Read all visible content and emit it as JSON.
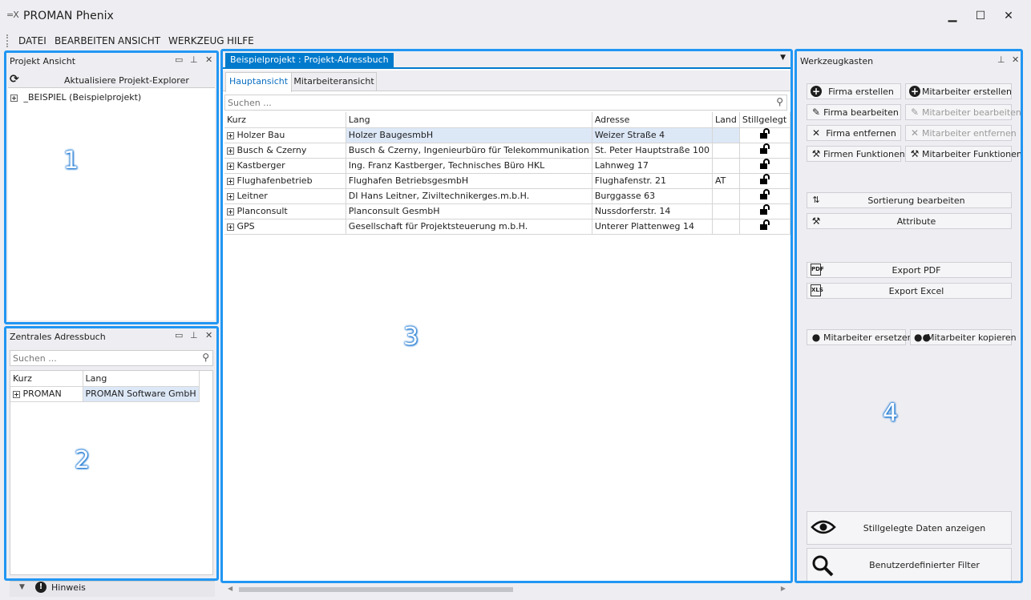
{
  "window": {
    "title": "PROMAN Phenix",
    "logo": "=X",
    "minimize": "▁",
    "maximize": "☐",
    "close": "✕"
  },
  "menu": [
    "DATEI",
    "BEARBEITEN",
    "ANSICHT",
    "WERKZEUG",
    "HILFE"
  ],
  "projekt_ansicht": {
    "title": "Projekt Ansicht",
    "refresh_label": "Aktualisiere Projekt-Explorer",
    "tree": [
      "_BEISPIEL (Beispielprojekt)"
    ],
    "marker": "1"
  },
  "adressbuch": {
    "title": "Zentrales Adressbuch",
    "search_placeholder": "Suchen ...",
    "columns": [
      "Kurz",
      "Lang"
    ],
    "rows": [
      {
        "kurz": "PROMAN",
        "lang": "PROMAN Software GmbH"
      }
    ],
    "marker": "2"
  },
  "hinweis": {
    "label": "Hinweis"
  },
  "center": {
    "doc_tab": "Beispielprojekt : Projekt-Adressbuch",
    "tabs": [
      "Hauptansicht",
      "Mitarbeiteransicht"
    ],
    "search_placeholder": "Suchen ...",
    "columns": [
      "Kurz",
      "Lang",
      "Adresse",
      "Land",
      "Stillgelegt"
    ],
    "rows": [
      {
        "kurz": "Holzer Bau",
        "lang": "Holzer BaugesmbH",
        "adresse": "Weizer Straße 4",
        "land": ""
      },
      {
        "kurz": "Busch & Czerny",
        "lang": "Busch & Czerny, Ingenieurbüro für Telekommunikation",
        "adresse": "St. Peter Hauptstraße 100",
        "land": ""
      },
      {
        "kurz": "Kastberger",
        "lang": "Ing. Franz Kastberger, Technisches Büro HKL",
        "adresse": "Lahnweg 17",
        "land": ""
      },
      {
        "kurz": "Flughafenbetrieb",
        "lang": "Flughafen BetriebsgesmbH",
        "adresse": "Flughafenstr. 21",
        "land": "AT"
      },
      {
        "kurz": "Leitner",
        "lang": "DI Hans Leitner, Ziviltechnikerges.m.b.H.",
        "adresse": "Burggasse 63",
        "land": ""
      },
      {
        "kurz": "Planconsult",
        "lang": "Planconsult GesmbH",
        "adresse": "Nussdorferstr. 14",
        "land": ""
      },
      {
        "kurz": "GPS",
        "lang": "Gesellschaft für Projektsteuerung m.b.H.",
        "adresse": "Unterer Plattenweg 14",
        "land": ""
      }
    ],
    "marker": "3"
  },
  "toolbox": {
    "title": "Werkzeugkasten",
    "buttons": {
      "firma_erstellen": "Firma erstellen",
      "mitarbeiter_erstellen": "Mitarbeiter erstellen",
      "firma_bearbeiten": "Firma bearbeiten",
      "mitarbeiter_bearbeiten": "Mitarbeiter bearbeiten",
      "firma_entfernen": "Firma entfernen",
      "mitarbeiter_entfernen": "Mitarbeiter entfernen",
      "firmen_funktionen": "Firmen Funktionen",
      "mitarbeiter_funktionen": "Mitarbeiter Funktionen",
      "sortierung": "Sortierung bearbeiten",
      "attribute": "Attribute",
      "export_pdf": "Export PDF",
      "export_excel": "Export Excel",
      "mitarbeiter_ersetzen": "Mitarbeiter ersetzen",
      "mitarbeiter_kopieren": "Mitarbeiter kopieren",
      "stillgelegte": "Stillgelegte Daten anzeigen",
      "filter": "Benutzerdefinierter Filter"
    },
    "marker": "4"
  },
  "icons": {
    "refresh": "refresh-icon",
    "search": "search-icon",
    "lock": "unlock-icon"
  }
}
